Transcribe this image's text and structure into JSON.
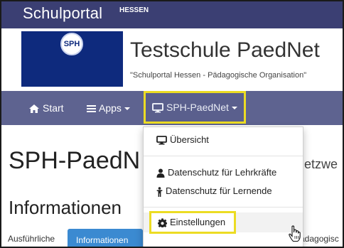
{
  "portal": {
    "brand": "Schulportal",
    "brand_sup": "HESSEN"
  },
  "school": {
    "logo_text": "SPH",
    "name": "Testschule PaedNet",
    "subtitle": "\"Schulportal Hessen - Pädagogische Organisation\""
  },
  "navbar": {
    "start_label": "Start",
    "apps_label": "Apps",
    "paednet_label": "SPH-PaedNet"
  },
  "dropdown": {
    "overview_label": "Übersicht",
    "privacy_teachers_label": "Datenschutz für Lehrkräfte",
    "privacy_students_label": "Datenschutz für Lernende",
    "settings_label": "Einstellungen"
  },
  "main": {
    "page_title": "SPH-PaedN",
    "page_title_right": "etzwe",
    "section_title": "Informationen",
    "tab_left": "Ausführliche",
    "tab_active": "Informationen",
    "tab_right": "ädagogisc"
  },
  "colors": {
    "topbar": "#3b3f73",
    "navbar": "#5e6390",
    "logo_bg": "#0e2a7d",
    "highlight": "#ecdc23",
    "tab_active": "#3b8ad1"
  },
  "icons": [
    "home-icon",
    "menu-icon",
    "monitor-icon",
    "user-icon",
    "person-icon",
    "gear-icon",
    "hand-cursor-icon"
  ]
}
